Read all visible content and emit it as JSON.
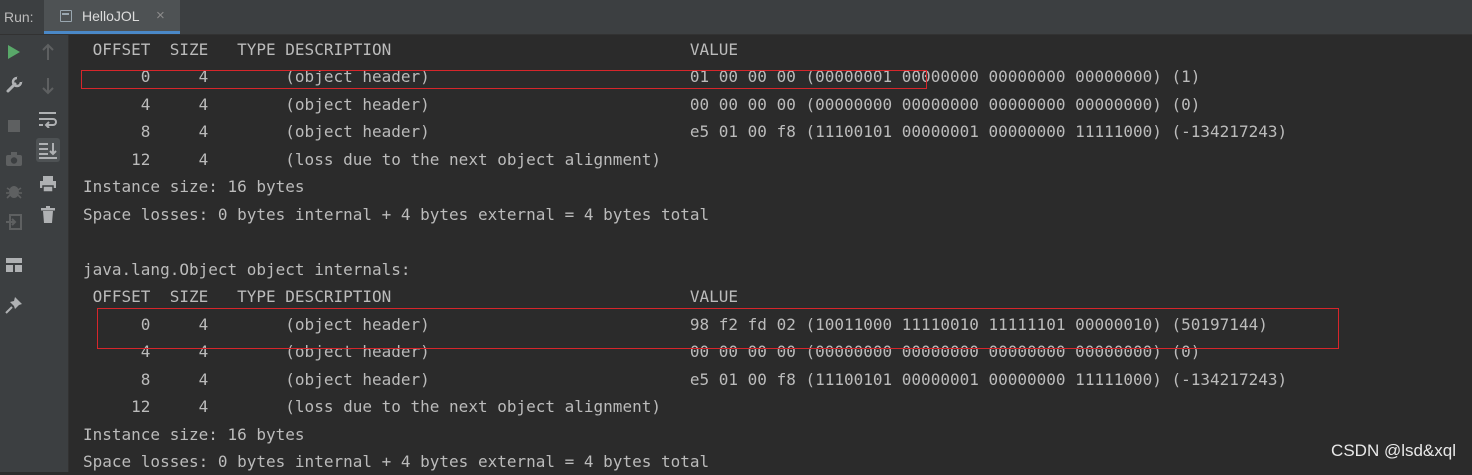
{
  "run_panel": {
    "label": "Run:",
    "tab": {
      "title": "HelloJOL",
      "close": "×"
    }
  },
  "toolbar_primary": [
    "run-icon",
    "wrench-icon",
    "stop-icon",
    "camera-icon",
    "bug-icon",
    "login-icon",
    "layout-icon",
    "pin-icon"
  ],
  "toolbar_secondary": [
    "arrow-up-icon",
    "arrow-down-icon",
    "soft-wrap-icon",
    "scroll-to-end-icon",
    "print-icon",
    "trash-icon"
  ],
  "console": {
    "lines": [
      " OFFSET  SIZE   TYPE DESCRIPTION                               VALUE",
      "      0     4        (object header)                           01 00 00 00 (00000001 00000000 00000000 00000000) (1)",
      "      4     4        (object header)                           00 00 00 00 (00000000 00000000 00000000 00000000) (0)",
      "      8     4        (object header)                           e5 01 00 f8 (11100101 00000001 00000000 11111000) (-134217243)",
      "     12     4        (loss due to the next object alignment)",
      "Instance size: 16 bytes",
      "Space losses: 0 bytes internal + 4 bytes external = 4 bytes total",
      "",
      "java.lang.Object object internals:",
      " OFFSET  SIZE   TYPE DESCRIPTION                               VALUE",
      "      0     4        (object header)                           98 f2 fd 02 (10011000 11110010 11111101 00000010) (50197144)",
      "      4     4        (object header)                           00 00 00 00 (00000000 00000000 00000000 00000000) (0)",
      "      8     4        (object header)                           e5 01 00 f8 (11100101 00000001 00000000 11111000) (-134217243)",
      "     12     4        (loss due to the next object alignment)",
      "Instance size: 16 bytes",
      "Space losses: 0 bytes internal + 4 bytes external = 4 bytes total"
    ]
  },
  "watermark": "CSDN @lsd&xql",
  "colors": {
    "background": "#2b2b2b",
    "toolbar": "#3c3f41",
    "text": "#bbbbbb",
    "highlight_box": "#d6262b",
    "run_green": "#59a869",
    "tab_underline": "#4a88c7"
  }
}
